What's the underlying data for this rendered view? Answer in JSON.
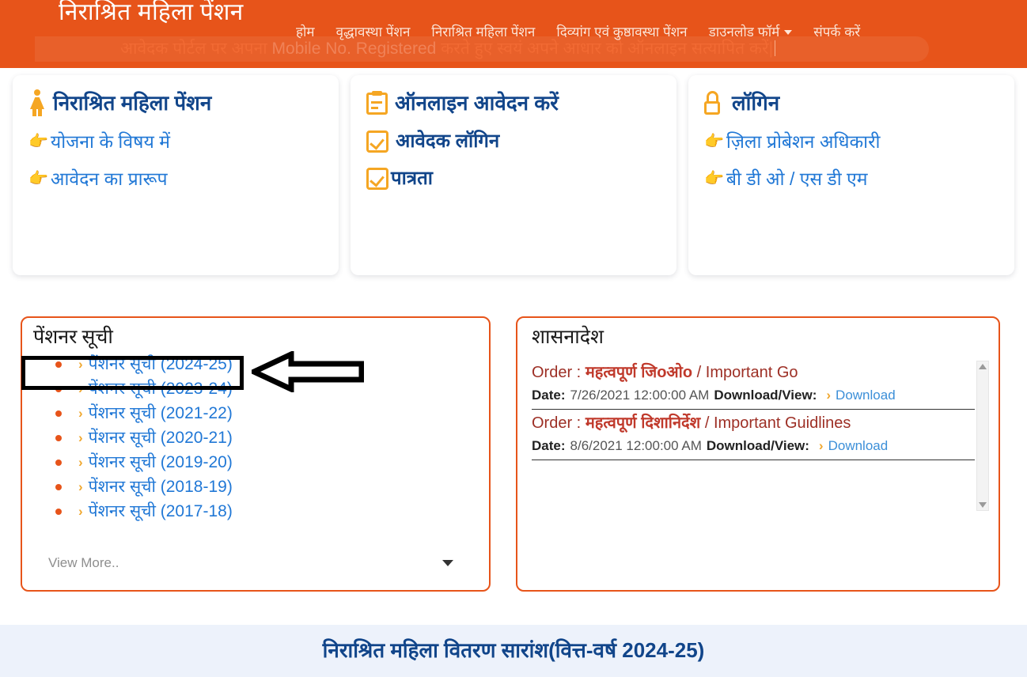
{
  "header": {
    "brand_title": "निराश्रित महिला पेंशन",
    "marquee_hi_1": "आवेदक पोर्टल पर अपना ",
    "marquee_en": "Mobile No. Registered",
    "marquee_hi_2": " करते हुए स्वयं अपने आधार को ऑनलाइन सत्यापित करें|",
    "accent_color": "#E7541A",
    "nav": [
      {
        "label": "होम",
        "has_caret": false
      },
      {
        "label": "वृद्धावस्था पेंशन",
        "has_caret": false
      },
      {
        "label": "निराश्रित महिला पेंशन",
        "has_caret": false
      },
      {
        "label": "दिव्यांग एवं कुष्ठावस्था पेंशन",
        "has_caret": false
      },
      {
        "label": "डाउनलोड फॉर्म",
        "has_caret": true
      },
      {
        "label": "संपर्क करें",
        "has_caret": false
      }
    ]
  },
  "cards": [
    {
      "icon": "woman-icon",
      "title": "निराश्रित महिला पेंशन",
      "links": [
        {
          "icon": "pointing-hand-icon",
          "label": "योजना के विषय में"
        },
        {
          "icon": "pointing-hand-icon",
          "label": "आवेदन का प्रारूप"
        }
      ]
    },
    {
      "icon": "clipboard-icon",
      "title": "ऑनलाइन आवेदन करें",
      "links": [
        {
          "icon": "checkbox-icon",
          "label": "आवेदक लॉगिन"
        },
        {
          "icon": "checkbox-icon",
          "label": "पात्रता"
        }
      ]
    },
    {
      "icon": "unlock-icon",
      "title": "लॉगिन",
      "links": [
        {
          "icon": "pointing-hand-icon",
          "label": "ज़िला प्रोबेशन अधिकारी"
        },
        {
          "icon": "pointing-hand-icon",
          "label": "बी डी ओ / एस डी एम"
        }
      ]
    }
  ],
  "pensioner_panel": {
    "title": "पेंशनर सूची",
    "items": [
      "पेंशनर सूची (2024-25)",
      "पेंशनर सूची (2023-24)",
      "पेंशनर सूची (2021-22)",
      "पेंशनर सूची (2020-21)",
      "पेंशनर सूची (2019-20)",
      "पेंशनर सूची (2018-19)",
      "पेंशनर सूची (2017-18)"
    ],
    "view_more": "View More.."
  },
  "orders_panel": {
    "title": "शासनादेश",
    "order_label": "Order :",
    "date_label": "Date:",
    "download_label": "Download/View:",
    "download_link": "Download",
    "orders": [
      {
        "name_hi": "महत्वपूर्ण जिoओo",
        "name_sep": " / ",
        "name_en": "Important Go",
        "date": "7/26/2021 12:00:00 AM"
      },
      {
        "name_hi": "महत्वपूर्ण दिशानिर्देश",
        "name_sep": " / ",
        "name_en": "Important Guidlines",
        "date": "8/6/2021 12:00:00 AM"
      }
    ]
  },
  "bottom": {
    "title": "निराश्रित महिला वितरण सारांश(वित्त-वर्ष 2024-25)"
  }
}
